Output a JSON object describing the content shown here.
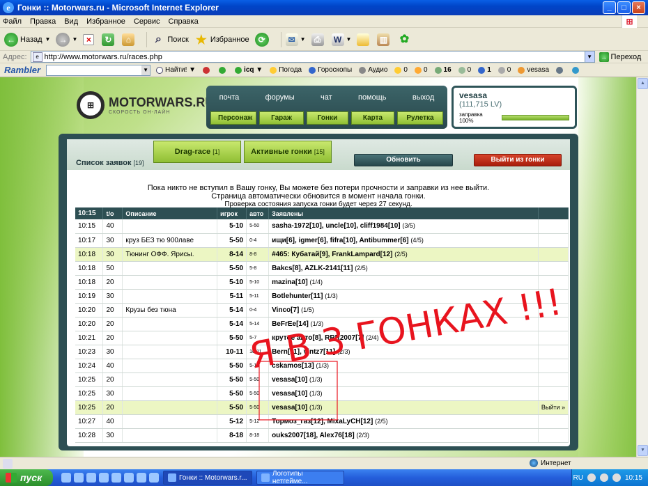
{
  "window": {
    "title": "Гонки :: Motorwars.ru - Microsoft Internet Explorer",
    "icon": "ie-icon"
  },
  "menu": [
    "Файл",
    "Правка",
    "Вид",
    "Избранное",
    "Сервис",
    "Справка"
  ],
  "toolbar": {
    "back": "Назад",
    "search": "Поиск",
    "favorites": "Избранное"
  },
  "address": {
    "label": "Адрес:",
    "url": "http://www.motorwars.ru/races.php",
    "go": "Переход"
  },
  "rambler": {
    "logo": "Rambler",
    "find": "Найти!",
    "icq": "icq",
    "weather": "Погода",
    "horoscope": "Гороскопы",
    "audio": "Аудио",
    "counters": [
      "0",
      "0",
      "16",
      "0",
      "1",
      "0"
    ],
    "user": "vesasa"
  },
  "site": {
    "logo_name": "MOTORWARS.RU",
    "logo_tagline": "СКОРОСТЬ ОН-ЛАЙН",
    "nav_top": [
      "почта",
      "форумы",
      "чат",
      "помощь",
      "выход"
    ],
    "nav_bottom": [
      "Персонаж",
      "Гараж",
      "Гонки",
      "Карта",
      "Рулетка"
    ],
    "user": {
      "name": "vesasa",
      "money": "(111,715 LV)",
      "fuel_label": "заправка 100%",
      "fuel": 1.0
    },
    "tabs": {
      "list_label": "Список заявок",
      "list_count": "[19]",
      "drag_label": "Drag-race",
      "drag_count": "[1]",
      "active_label": "Активные гонки",
      "active_count": "[15]",
      "refresh": "Обновить",
      "exit": "Выйти из гонки"
    },
    "notice": {
      "line1": "Пока никто не вступил в Вашу гонку, Вы можете без потери прочности и заправки из нее выйти.",
      "line2": "Страница автоматически обновится в момент начала гонки.",
      "line3": "Проверка состояния запуска гонки будет через 27 секунд."
    },
    "table": {
      "headers": [
        "10:15",
        "t/o",
        "Описание",
        "игрок",
        "авто",
        "Заявлены"
      ],
      "rows": [
        {
          "time": "10:15",
          "to": "40",
          "desc": "",
          "lvl": "5-10",
          "auto": "5-50",
          "players": "sasha-1972[10], uncle[10], cliff1984[10]",
          "count": "(3/5)",
          "hl": false,
          "action": ""
        },
        {
          "time": "10:17",
          "to": "30",
          "desc": "круз БЕЗ тю 900лаве",
          "lvl": "5-50",
          "auto": "0-4",
          "players": "ищи[6], igmer[6], fifra[10], Antibummer[6]",
          "count": "(4/5)",
          "hl": false,
          "action": ""
        },
        {
          "time": "10:18",
          "to": "30",
          "desc": "Тюнинг ОФФ. Ярисы.",
          "lvl": "8-14",
          "auto": "8-8",
          "players": "#465: Кубатай[9], FrankLampard[12]",
          "count": "(2/5)",
          "hl": true,
          "action": ""
        },
        {
          "time": "10:18",
          "to": "50",
          "desc": "",
          "lvl": "5-50",
          "auto": "5-8",
          "players": "Bakcs[8], AZLK-2141[11]",
          "count": "(2/5)",
          "hl": false,
          "action": ""
        },
        {
          "time": "10:18",
          "to": "20",
          "desc": "",
          "lvl": "5-10",
          "auto": "5-10",
          "players": "mazina[10]",
          "count": "(1/4)",
          "hl": false,
          "action": ""
        },
        {
          "time": "10:19",
          "to": "30",
          "desc": "",
          "lvl": "5-11",
          "auto": "5-11",
          "players": "Botlehunter[11]",
          "count": "(1/3)",
          "hl": false,
          "action": ""
        },
        {
          "time": "10:20",
          "to": "20",
          "desc": "Крузы без тюна",
          "lvl": "5-14",
          "auto": "0-4",
          "players": "Vinco[7]",
          "count": "(1/5)",
          "hl": false,
          "action": ""
        },
        {
          "time": "10:20",
          "to": "20",
          "desc": "",
          "lvl": "5-14",
          "auto": "5-14",
          "players": "BeFrEe[14]",
          "count": "(1/3)",
          "hl": false,
          "action": ""
        },
        {
          "time": "10:21",
          "to": "20",
          "desc": "",
          "lvl": "5-50",
          "auto": "5-7",
          "players": "крутое авто[8], RRR2007[7]",
          "count": "(2/4)",
          "hl": false,
          "action": ""
        },
        {
          "time": "10:23",
          "to": "30",
          "desc": "",
          "lvl": "10-11",
          "auto": "10-11",
          "players": "Bern[11], vintz7[11]",
          "count": "(2/3)",
          "hl": false,
          "action": ""
        },
        {
          "time": "10:24",
          "to": "40",
          "desc": "",
          "lvl": "5-50",
          "auto": "5-13",
          "players": "cskamos[13]",
          "count": "(1/3)",
          "hl": false,
          "action": ""
        },
        {
          "time": "10:25",
          "to": "20",
          "desc": "",
          "lvl": "5-50",
          "auto": "5-50",
          "players": "vesasa[10]",
          "count": "(1/3)",
          "hl": false,
          "action": ""
        },
        {
          "time": "10:25",
          "to": "30",
          "desc": "",
          "lvl": "5-50",
          "auto": "5-50",
          "players": "vesasa[10]",
          "count": "(1/3)",
          "hl": false,
          "action": ""
        },
        {
          "time": "10:25",
          "to": "20",
          "desc": "",
          "lvl": "5-50",
          "auto": "5-50",
          "players": "vesasa[10]",
          "count": "(1/3)",
          "hl": true,
          "action": "Выйти »"
        },
        {
          "time": "10:27",
          "to": "40",
          "desc": "",
          "lvl": "5-12",
          "auto": "5-12",
          "players": "Тормоз_газ[12], MixaLyCH[12]",
          "count": "(2/5)",
          "hl": false,
          "action": ""
        },
        {
          "time": "10:28",
          "to": "30",
          "desc": "",
          "lvl": "8-18",
          "auto": "8-18",
          "players": "ouks2007[18], Alex76[18]",
          "count": "(2/3)",
          "hl": false,
          "action": ""
        }
      ]
    }
  },
  "overlay_text": "Я В 3 ГОНКАХ !!!",
  "status": {
    "zone": "Интернет"
  },
  "taskbar": {
    "start": "пуск",
    "task1": "Гонки :: Motorwars.r...",
    "task2": "Логотипы нетгейме...",
    "lang": "RU",
    "clock": "10:15"
  },
  "colors": {
    "accent_green": "#8fbf34",
    "panel_teal": "#2d4f53",
    "exit_red": "#c02d14",
    "ink_red": "#e8141e"
  }
}
